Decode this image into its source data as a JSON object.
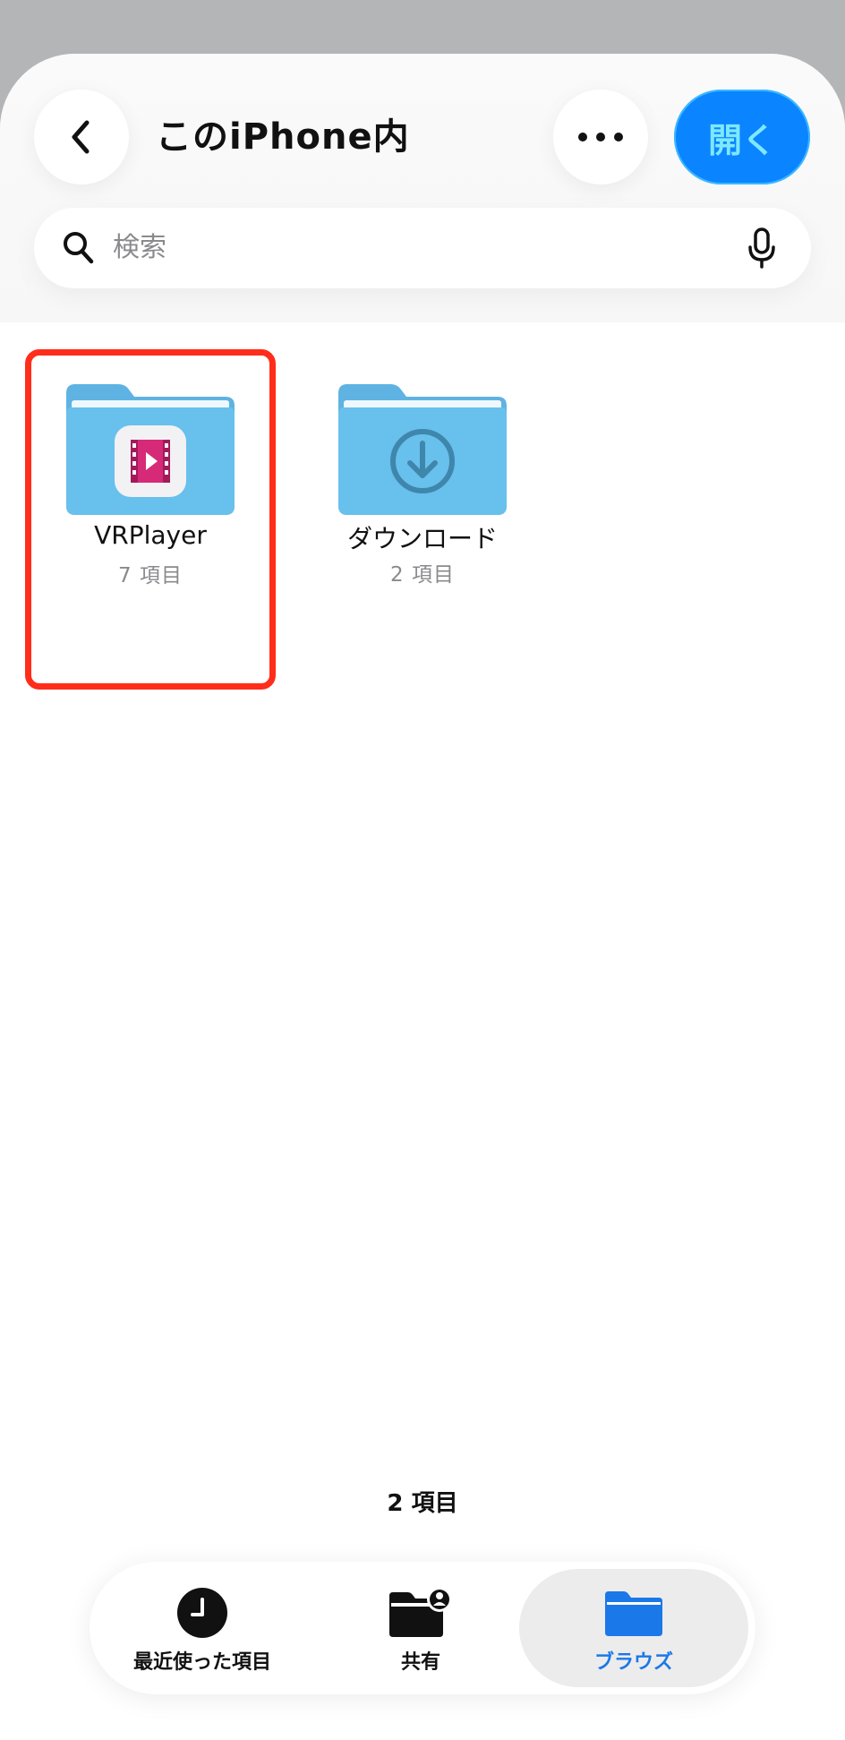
{
  "header": {
    "title": "このiPhone内",
    "open_label": "開く"
  },
  "search": {
    "placeholder": "検索"
  },
  "folders": [
    {
      "name": "VRPlayer",
      "count": "7 項目",
      "icon": "video-app-icon",
      "selected": true
    },
    {
      "name": "ダウンロード",
      "count": "2 項目",
      "icon": "download-arrow-icon",
      "selected": false
    }
  ],
  "footer": {
    "item_total": "2 項目"
  },
  "tabs": [
    {
      "label": "最近使った項目",
      "icon": "clock-icon"
    },
    {
      "label": "共有",
      "icon": "shared-folder-icon"
    },
    {
      "label": "ブラウズ",
      "icon": "folder-icon",
      "active": true
    }
  ],
  "colors": {
    "accent": "#0a84ff",
    "selection_outline": "#ff2d1a",
    "folder_blue": "#66bde9"
  }
}
